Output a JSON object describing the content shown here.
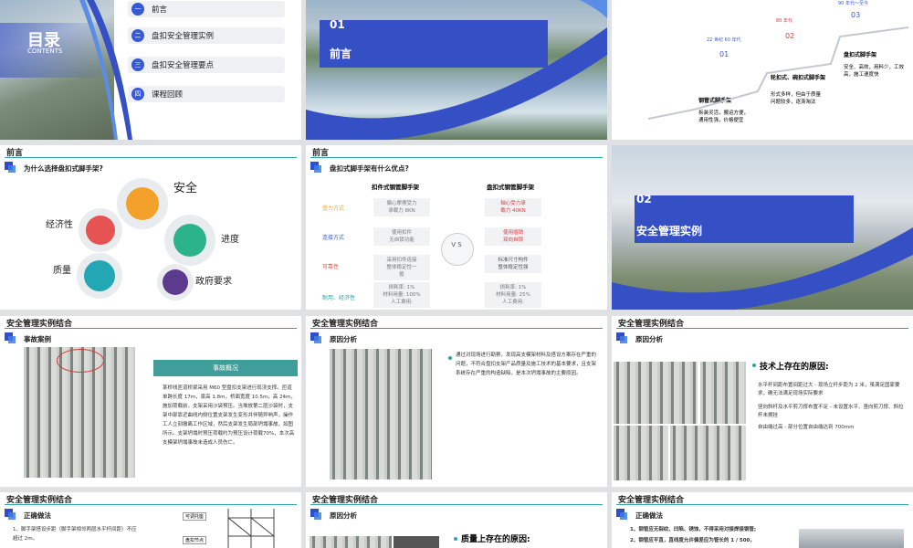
{
  "s1": {
    "title": "目录",
    "subtitle": "CONTENTS",
    "items": [
      {
        "num": "一",
        "label": "前言"
      },
      {
        "num": "二",
        "label": "盘扣安全管理实例"
      },
      {
        "num": "三",
        "label": "盘扣安全管理要点"
      },
      {
        "num": "四",
        "label": "课程回顾"
      }
    ]
  },
  "s2": {
    "num": "01",
    "title": "前言"
  },
  "s3": {
    "steps": [
      {
        "num": "01",
        "tag": "22 世纪 60 年代",
        "title": "钢管式脚手架",
        "desc": "拆装灵活，搬运方便，通用性强，价格便宜"
      },
      {
        "num": "02",
        "tag": "80 年代",
        "title": "轮扣式、碗扣式脚手架",
        "desc": "形式多样，但由于质量问题较多，逐渐淘汰"
      },
      {
        "num": "03",
        "tag": "90 年代～至今",
        "title": "盘扣式脚手架",
        "desc": "安全、高效，用料少，工效高，施工速度快"
      }
    ]
  },
  "s4": {
    "header": "前言",
    "sub": "为什么选择盘扣式脚手架?",
    "labels": {
      "safety": "安全",
      "economy": "经济性",
      "progress": "进度",
      "quality": "质量",
      "gov": "政府要求"
    }
  },
  "s5": {
    "header": "前言",
    "sub": "盘扣式脚手架有什么优点?",
    "col1": "扣件式钢管脚手架",
    "col2": "盘扣式钢管脚手架",
    "vs": "V S",
    "rows": [
      {
        "k": "受力方式",
        "a": "偏心摩擦受力\n承载力 8KN",
        "b": "轴心受力承\n载力 40KN"
      },
      {
        "k": "连接方式",
        "a": "使用扣件\n无自锁功能",
        "b": "使用插销\n双向自锁"
      },
      {
        "k": "可靠性",
        "a": "采用扣件连接\n整体稳定性一\n般",
        "b": "标准尺寸构件\n整体稳定性强"
      },
      {
        "k": "耐用、经济性",
        "a": "损耗率: 1%\n材料用量: 100%\n人工费用:",
        "b": "损耗率: 1%\n材料用量: 25%\n人工费用:"
      }
    ]
  },
  "s6": {
    "num": "02",
    "title": "安全管理实例"
  },
  "s7": {
    "header": "安全管理实例结合",
    "sub": "事故案例",
    "box": "事故概况",
    "text": "某桥线匝道桥梁采用 M60 型盘扣支架进行现浇支撑。匝道单跨长度 17m，梁高 1.8m，桥面宽度 10.5m，高 24m，施加荷载前，支架采用沙袋预压。当堆放第二层沙袋时，支架中部靠近曲线内侧位置支架发生变形并伴随异响声，操作工人立刻撤离工作区域，然后支架发生局部坍塌事故，如图所示。支架坍塌时预压荷载约为预压设计荷载70%，本次高支模架坍塌事故未造成人员伤亡。"
  },
  "s8": {
    "header": "安全管理实例结合",
    "sub": "原因分析",
    "text": "通过对现场进行勘察，发现高支模架材料及搭设方案存在严重的问题，不符合盘扣支架产品质量及施工技术的基本要求，且支架系统存在严重的构造缺陷，是本次坍塌事故的主要原因。"
  },
  "s9": {
    "header": "安全管理实例结合",
    "sub": "原因分析",
    "heading": "技术上存在的原因:",
    "bullets": [
      "水平杆间距布置间距过大 - 现场立杆步距为 2 米，虽满足国家要求，确无法满足现场实际要求",
      "竖向斜杆及水平剪刀撑布置不足 - 未设置水平、竖向剪刀撑、斜拉杆未拥挂",
      "自由端过高 - 部分位置自由端达到 700mm"
    ]
  },
  "s10": {
    "header": "安全管理实例结合",
    "sub": "正确做法",
    "text": "1、脚手架搭设步距（脚手架相邻两层水平杆间距）不应超过 2m。",
    "label1": "可调托座",
    "label2": "盘扣节点"
  },
  "s11": {
    "header": "安全管理实例结合",
    "sub": "原因分析",
    "heading": "质量上存在的原因:"
  },
  "s12": {
    "header": "安全管理实例结合",
    "sub": "正确做法",
    "items": [
      "1、钢管应无裂纹、凹陷、锈蚀，不得采用对接焊接钢管;",
      "2、钢管应平直，直线度允许偏差应为管长的 1 / 500，"
    ]
  },
  "colors": {
    "blue": "#3550c4",
    "teal": "#2fa3a8",
    "orange": "#f3a12b",
    "red": "#e55353",
    "green": "#2bb38b",
    "cyan": "#23a7b5",
    "purple": "#5c3a8e"
  }
}
